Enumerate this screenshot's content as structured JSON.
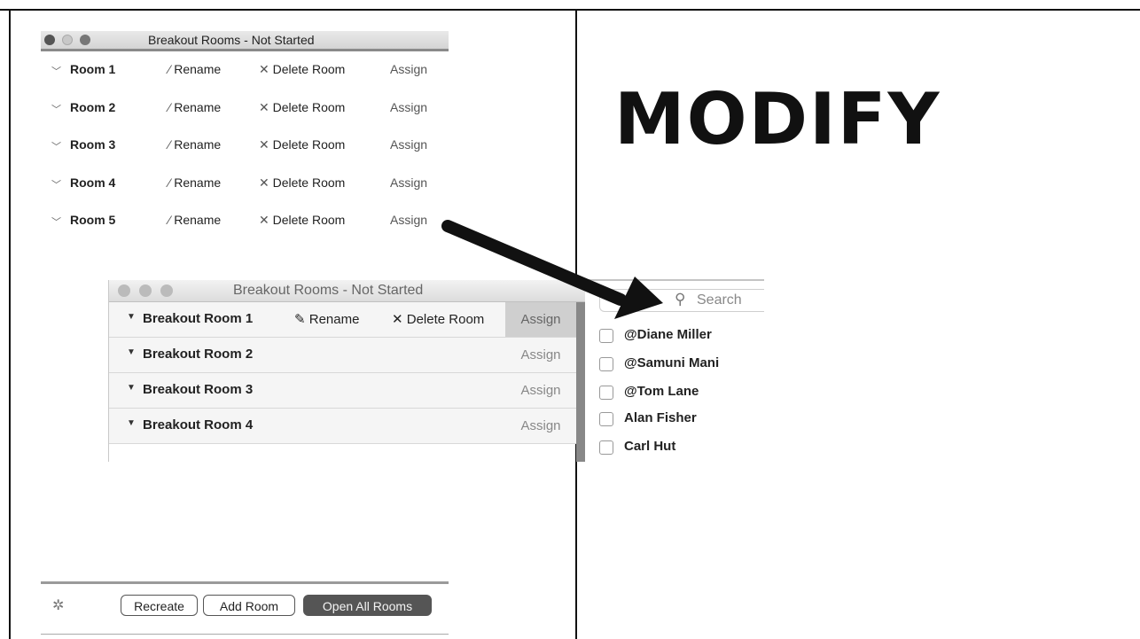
{
  "window_top": {
    "title": "Breakout Rooms - Not Started",
    "rooms": [
      {
        "name": "Room 1",
        "rename": "Rename",
        "delete": "Delete Room",
        "assign": "Assign"
      },
      {
        "name": "Room 2",
        "rename": "Rename",
        "delete": "Delete Room",
        "assign": "Assign"
      },
      {
        "name": "Room 3",
        "rename": "Rename",
        "delete": "Delete Room",
        "assign": "Assign"
      },
      {
        "name": "Room 4",
        "rename": "Rename",
        "delete": "Delete Room",
        "assign": "Assign"
      },
      {
        "name": "Room 5",
        "rename": "Rename",
        "delete": "Delete Room",
        "assign": "Assign"
      }
    ],
    "footer": {
      "recreate": "Recreate",
      "add_room": "Add Room",
      "open_all": "Open All Rooms"
    }
  },
  "window_bottom": {
    "title": "Breakout Rooms - Not Started",
    "rooms": [
      {
        "name": "Breakout Room 1",
        "rename": "Rename",
        "delete": "Delete Room",
        "assign": "Assign"
      },
      {
        "name": "Breakout Room 2",
        "assign": "Assign"
      },
      {
        "name": "Breakout Room 3",
        "assign": "Assign"
      },
      {
        "name": "Breakout Room 4",
        "assign": "Assign"
      }
    ]
  },
  "assign_popover": {
    "search_placeholder": "Search",
    "participants": [
      "@Diane Miller",
      "@Samuni Mani",
      "@Tom Lane",
      "Alan Fisher",
      "Carl Hut"
    ]
  },
  "headline": "MODIFY",
  "icons": {
    "chevron": "chevron-down-icon",
    "rename": "pencil-icon",
    "delete": "x-icon",
    "settings": "gear-icon",
    "expand": "triangle-down-icon",
    "search": "search-icon"
  }
}
